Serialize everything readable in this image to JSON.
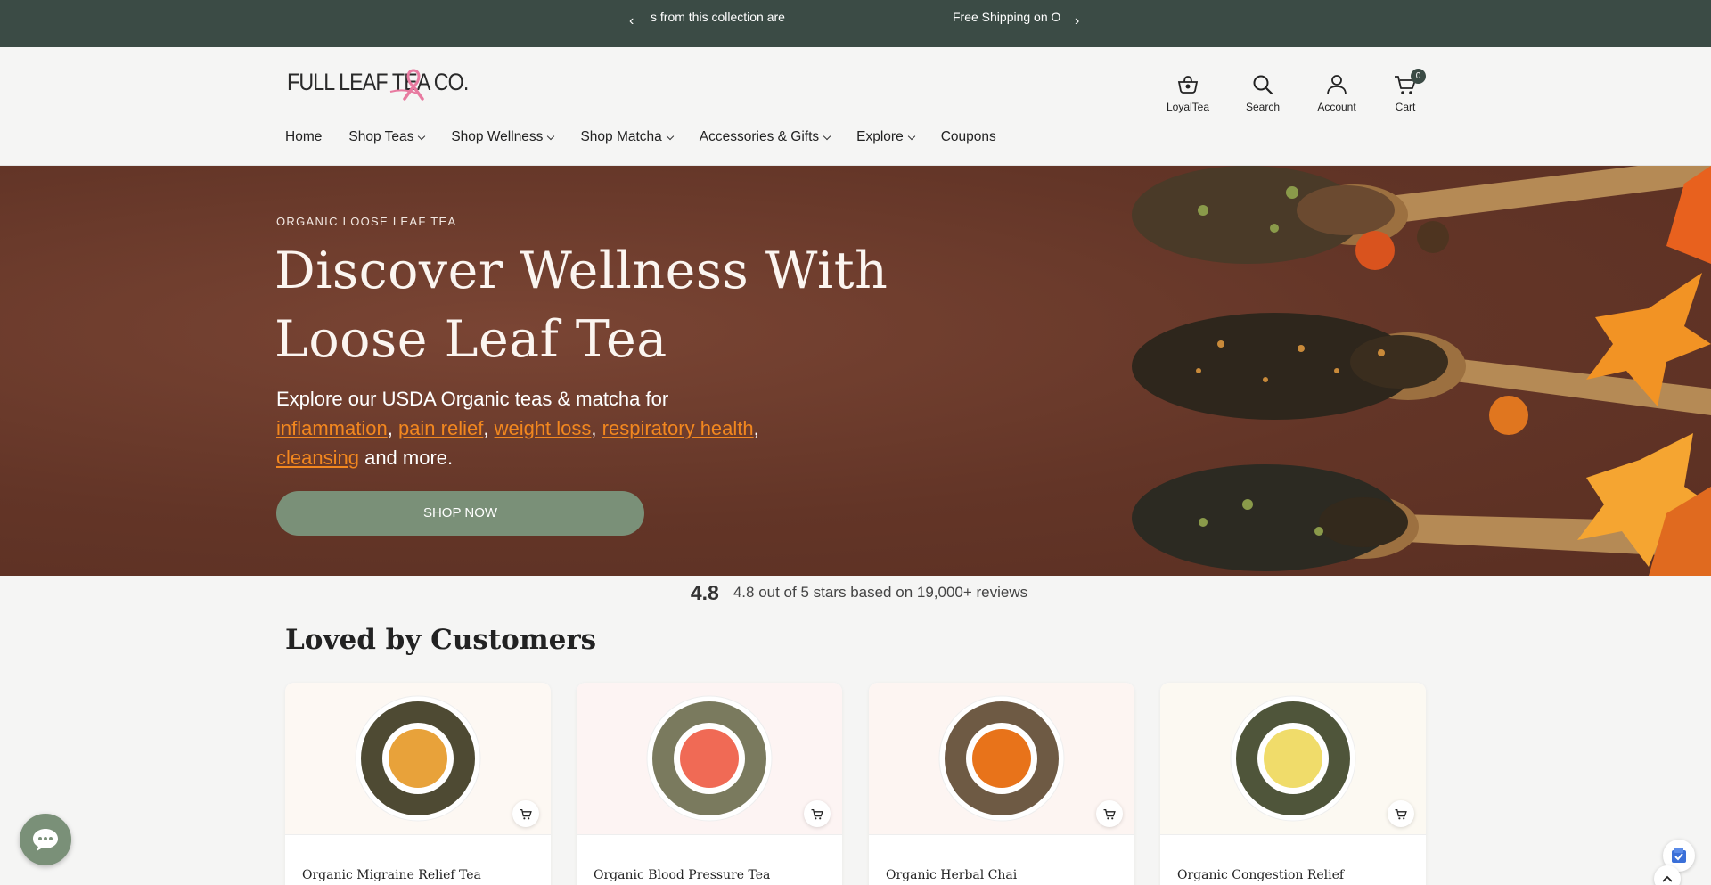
{
  "announcement": {
    "prev_icon": "chevron-left-icon",
    "next_icon": "chevron-right-icon",
    "message_1": "s from this collection are",
    "message_2": "Free Shipping on Or"
  },
  "header": {
    "logo_text": "FULL LEAF TEA CO.",
    "logo_icon": "pink-ribbon-icon",
    "utilities": [
      {
        "label": "LoyalTea",
        "icon": "loyalty-tea-icon"
      },
      {
        "label": "Search",
        "icon": "search-icon"
      },
      {
        "label": "Account",
        "icon": "account-icon"
      },
      {
        "label": "Cart",
        "icon": "cart-icon",
        "count": "0"
      }
    ],
    "nav": [
      {
        "label": "Home",
        "dropdown": false
      },
      {
        "label": "Shop Teas",
        "dropdown": true
      },
      {
        "label": "Shop Wellness",
        "dropdown": true
      },
      {
        "label": "Shop Matcha",
        "dropdown": true
      },
      {
        "label": "Accessories & Gifts",
        "dropdown": true
      },
      {
        "label": "Explore",
        "dropdown": true
      },
      {
        "label": "Coupons",
        "dropdown": false
      }
    ]
  },
  "hero": {
    "eyebrow": "ORGANIC LOOSE LEAF TEA",
    "title": "Discover Wellness With Loose Leaf Tea",
    "copy_intro": "Explore our USDA Organic teas & matcha for",
    "links": [
      "inflammation",
      "pain relief",
      "weight loss",
      "respiratory health",
      "cleansing"
    ],
    "copy_outro": "and more.",
    "cta": "SHOP NOW",
    "accent_color": "#f2871f",
    "background_color": "#6a3a2c"
  },
  "rating": {
    "glyph": "",
    "score": "4.8",
    "stars": "",
    "summary": "4.8 out of 5 stars based on 19,000+ reviews"
  },
  "section": {
    "title": "Loved by Customers",
    "products": [
      {
        "name": "Organic Migraine Relief Tea",
        "stars": "",
        "liquid_color": "#e8a23a"
      },
      {
        "name": "Organic Blood Pressure Tea",
        "stars": "",
        "liquid_color": "#f06a55"
      },
      {
        "name": "Organic Herbal Chai",
        "stars": "",
        "liquid_color": "#e8731a"
      },
      {
        "name": "Organic Congestion Relief",
        "stars": "",
        "liquid_color": "#f0dc6a"
      }
    ]
  },
  "floating": {
    "chat_icon": "chat-bubble-icon",
    "badge_icon": "shield-badge-icon",
    "scroll_icon": "chevron-up-icon"
  }
}
